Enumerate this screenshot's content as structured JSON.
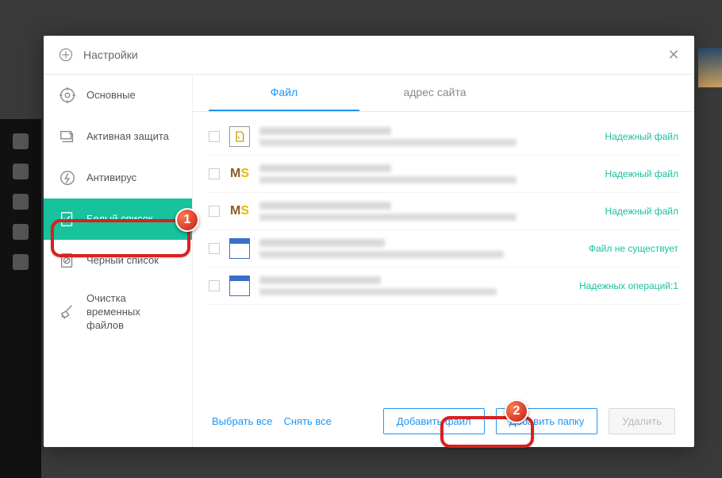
{
  "header": {
    "title": "Настройки"
  },
  "sidebar": {
    "items": [
      {
        "label": "Основные"
      },
      {
        "label": "Активная защита"
      },
      {
        "label": "Антивирус"
      },
      {
        "label": "Белый список"
      },
      {
        "label": "Черный список"
      },
      {
        "label": "Очистка временных файлов"
      }
    ]
  },
  "tabs": {
    "file": "Файл",
    "site": "адрес сайта"
  },
  "list": {
    "rows": [
      {
        "icon": "script",
        "status": "Надежный файл"
      },
      {
        "icon": "ms",
        "status": "Надежный файл"
      },
      {
        "icon": "ms",
        "status": "Надежный файл"
      },
      {
        "icon": "window",
        "status": "Файл не существует"
      },
      {
        "icon": "window",
        "status": "Надежных операций:1"
      }
    ]
  },
  "footer": {
    "select_all": "Выбрать все",
    "deselect_all": "Снять все",
    "add_file": "Добавить файл",
    "add_folder": "Добавить папку",
    "delete": "Удалить"
  },
  "annotations": {
    "n1": "1",
    "n2": "2"
  }
}
